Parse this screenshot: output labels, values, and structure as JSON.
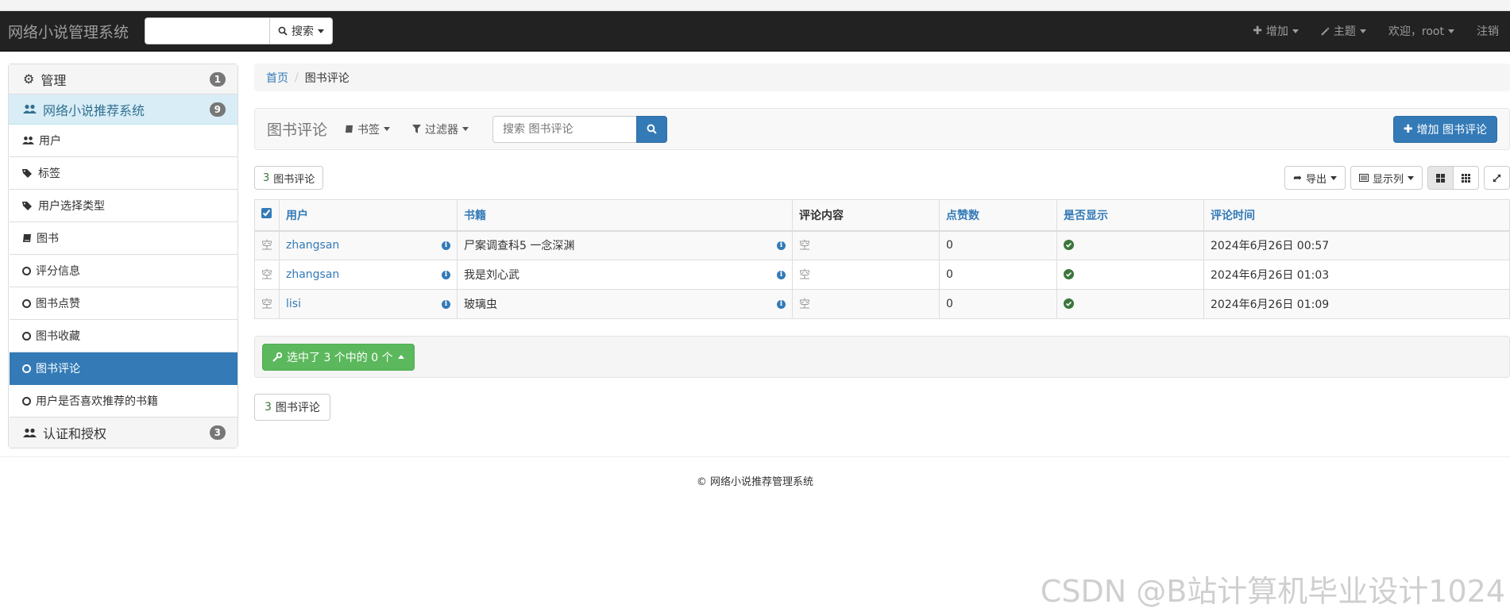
{
  "navbar": {
    "brand": "网络小说管理系统",
    "search_placeholder": "",
    "search_button": "搜索",
    "add": "增加",
    "theme": "主题",
    "welcome": "欢迎，root",
    "logout": "注销"
  },
  "sidebar": {
    "groups": [
      {
        "label": "管理",
        "badge": "1"
      },
      {
        "label": "网络小说推荐系统",
        "badge": "9"
      },
      {
        "label": "认证和授权",
        "badge": "3"
      }
    ],
    "items": [
      {
        "label": "用户",
        "icon": "users-icon"
      },
      {
        "label": "标签",
        "icon": "tags-icon"
      },
      {
        "label": "用户选择类型",
        "icon": "tags-icon"
      },
      {
        "label": "图书",
        "icon": "book-icon"
      },
      {
        "label": "评分信息",
        "icon": "circle-icon"
      },
      {
        "label": "图书点赞",
        "icon": "circle-icon"
      },
      {
        "label": "图书收藏",
        "icon": "circle-icon"
      },
      {
        "label": "图书评论",
        "icon": "circle-icon",
        "active": true
      },
      {
        "label": "用户是否喜欢推荐的书籍",
        "icon": "circle-icon"
      }
    ]
  },
  "breadcrumb": {
    "home": "首页",
    "current": "图书评论"
  },
  "toolbar": {
    "title": "图书评论",
    "bookmarks": "书签",
    "filters": "过滤器",
    "search_placeholder": "搜索 图书评论",
    "add_button": "增加 图书评论"
  },
  "counts": {
    "num": "3",
    "label": "图书评论"
  },
  "table_tools": {
    "export": "导出",
    "columns": "显示列"
  },
  "table": {
    "headers": [
      "用户",
      "书籍",
      "评论内容",
      "点赞数",
      "是否显示",
      "评论时间"
    ],
    "rows": [
      {
        "mark": "空",
        "user": "zhangsan",
        "book": "尸案调查科5 一念深渊",
        "content": "空",
        "likes": "0",
        "time": "2024年6月26日 00:57"
      },
      {
        "mark": "空",
        "user": "zhangsan",
        "book": "我是刘心武",
        "content": "空",
        "likes": "0",
        "time": "2024年6月26日 01:03"
      },
      {
        "mark": "空",
        "user": "lisi",
        "book": "玻璃虫",
        "content": "空",
        "likes": "0",
        "time": "2024年6月26日 01:09"
      }
    ]
  },
  "actions": {
    "selected": "选中了 3 个中的 0 个"
  },
  "footer": {
    "text": "© 网络小说推荐管理系统"
  },
  "watermark": "CSDN @B站计算机毕业设计1024",
  "colors": {
    "navbar": "#222222",
    "primary": "#337ab7",
    "success": "#5cb85c",
    "ok": "#3c763d"
  }
}
